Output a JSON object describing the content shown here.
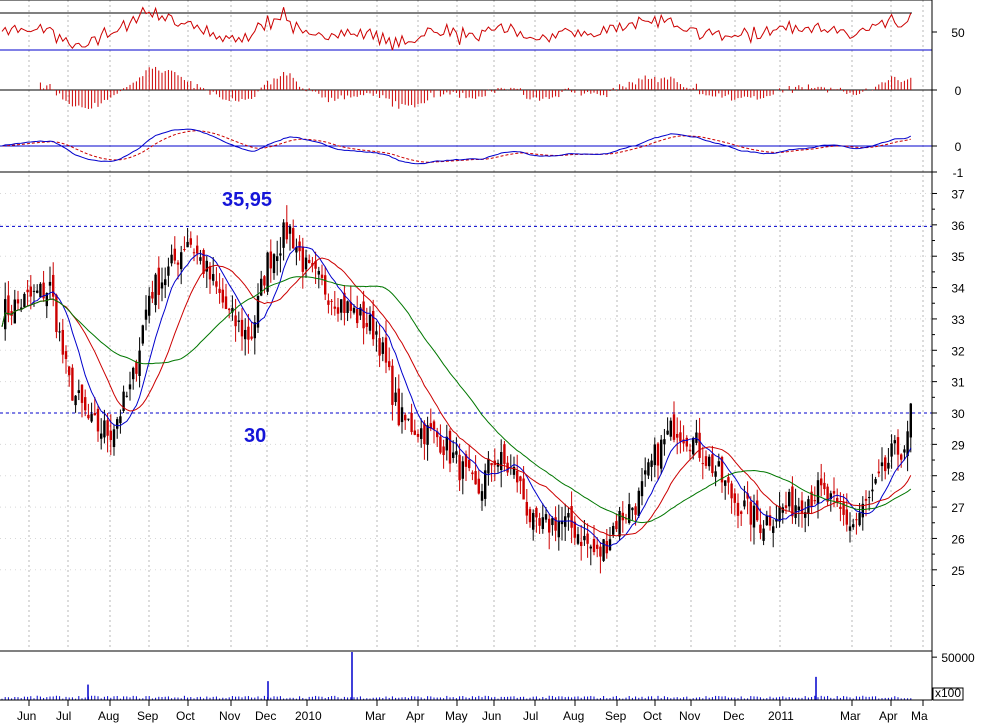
{
  "chart_data": {
    "type": "line",
    "panels": {
      "rsi": {
        "ticks": [
          {
            "value": 50,
            "label": "50"
          }
        ]
      },
      "histogram": {
        "ticks": [
          {
            "value": 0,
            "label": "0"
          }
        ]
      },
      "macd": {
        "ticks": [
          {
            "value": 0,
            "label": "0"
          },
          {
            "value": -1,
            "label": "-1"
          }
        ]
      },
      "price": {
        "ylim": [
          24.4,
          37.2
        ],
        "ticks": [
          25,
          26,
          27,
          28,
          29,
          30,
          31,
          32,
          33,
          34,
          35,
          36,
          37
        ],
        "reference_lines": [
          35.95,
          30
        ],
        "annotations": [
          {
            "text": "35,95",
            "at_value": 35.95
          },
          {
            "text": "30",
            "at_value": 30
          }
        ],
        "series": [
          {
            "type": "candlestick",
            "color": "#000000",
            "accent": "#cc0000"
          },
          {
            "type": "moving-average",
            "color": "#0000cc"
          },
          {
            "type": "moving-average",
            "color": "#cc0000"
          },
          {
            "type": "moving-average",
            "color": "#007700"
          }
        ],
        "close_path": [
          [
            "Jun",
            33.2
          ],
          [
            "Jun",
            34.0
          ],
          [
            "Jul",
            31.0
          ],
          [
            "Jul",
            29.6
          ],
          [
            "Aug",
            29.4
          ],
          [
            "Aug",
            30.8
          ],
          [
            "Sep",
            33.8
          ],
          [
            "Sep",
            34.6
          ],
          [
            "Oct",
            35.6
          ],
          [
            "Oct",
            34.2
          ],
          [
            "Nov",
            33.0
          ],
          [
            "Nov",
            32.4
          ],
          [
            "Dec",
            34.8
          ],
          [
            "Dec",
            35.9
          ],
          [
            "2010",
            34.5
          ],
          [
            "2010",
            33.4
          ],
          [
            "Mar",
            32.6
          ],
          [
            "Mar",
            29.8
          ],
          [
            "Apr",
            29.5
          ],
          [
            "Apr",
            29.2
          ],
          [
            "May",
            28.4
          ],
          [
            "May",
            27.4
          ],
          [
            "Jun",
            28.6
          ],
          [
            "Jun",
            28.0
          ],
          [
            "Jul",
            26.2
          ],
          [
            "Jul",
            26.6
          ],
          [
            "Aug",
            26.3
          ],
          [
            "Aug",
            25.4
          ],
          [
            "Sep",
            26.6
          ],
          [
            "Sep",
            27.2
          ],
          [
            "Oct",
            28.6
          ],
          [
            "Oct",
            29.6
          ],
          [
            "Nov",
            29.2
          ],
          [
            "Nov",
            28.2
          ],
          [
            "Dec",
            27.2
          ],
          [
            "Dec",
            26.5
          ],
          [
            "2011",
            26.9
          ],
          [
            "2011",
            27.5
          ],
          [
            "Mar",
            26.4
          ],
          [
            "Mar",
            27.4
          ],
          [
            "Apr",
            28.6
          ],
          [
            "Apr",
            29.1
          ],
          [
            "Ma",
            30.3
          ]
        ]
      },
      "volume": {
        "ticks": [
          {
            "value": 50000,
            "label": "50000"
          }
        ],
        "scale_label": "x100",
        "spikes": [
          [
            "Jul",
            18000
          ],
          [
            "Dec",
            22000
          ],
          [
            "Mar",
            56000
          ],
          [
            "2011",
            27000
          ]
        ]
      }
    },
    "x_tick_labels": [
      "Jun",
      "Jul",
      "Aug",
      "Sep",
      "Oct",
      "Nov",
      "Dec",
      "2010",
      "Mar",
      "Apr",
      "May",
      "Jun",
      "Jul",
      "Aug",
      "Sep",
      "Oct",
      "Nov",
      "Dec",
      "2011",
      "Mar",
      "Apr",
      "Ma"
    ],
    "grid": true
  }
}
